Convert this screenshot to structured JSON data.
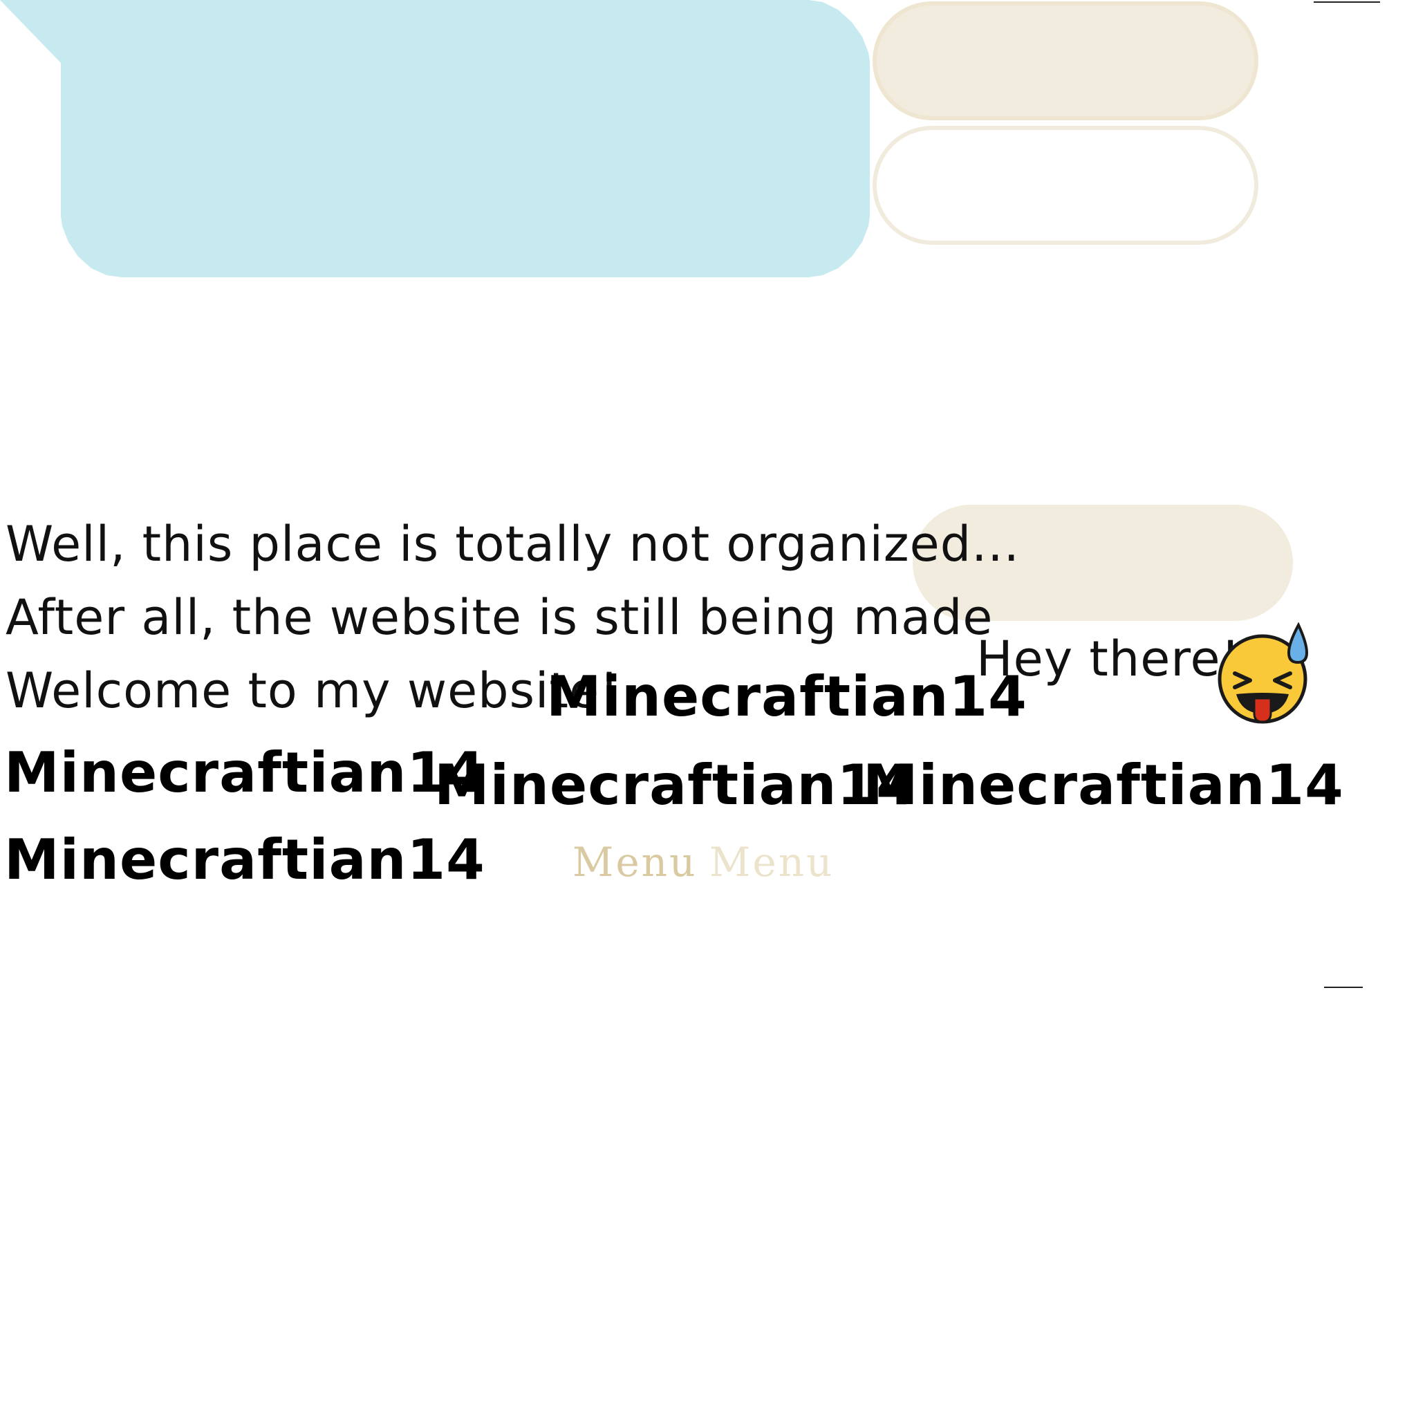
{
  "messages": {
    "line1": "Well, this place is totally not organized...",
    "line2": "After all, the website is still being made",
    "line3": "Welcome to my website!",
    "greeting": "Hey there!"
  },
  "names": [
    "Minecraftian14",
    "Minecraftian14",
    "Minecraftian14",
    "Minecraftian14",
    "Minecraftian14"
  ],
  "menu": {
    "label_primary": "Menu",
    "label_secondary": "Menu"
  },
  "icons": {
    "emoji": "squinting-face-with-tongue-and-sweat-icon"
  },
  "colors": {
    "panel_blue": "#c7eaf0",
    "pill_cream": "#f2ecde",
    "menu_gold": "#d9caa2",
    "menu_light": "#ece3cc"
  }
}
